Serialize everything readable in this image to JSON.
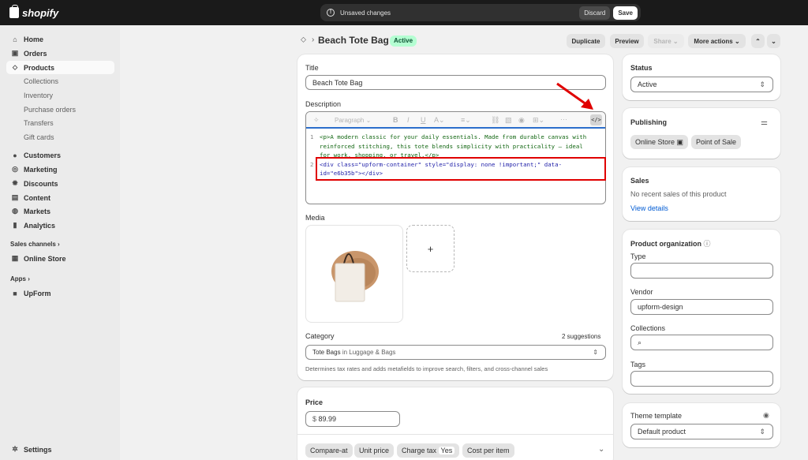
{
  "topbar": {
    "brand": "shopify",
    "unsaved": "Unsaved changes",
    "discard": "Discard",
    "save": "Save"
  },
  "sidebar": {
    "home": "Home",
    "orders": "Orders",
    "products": "Products",
    "collections": "Collections",
    "inventory": "Inventory",
    "purchase_orders": "Purchase orders",
    "transfers": "Transfers",
    "gift_cards": "Gift cards",
    "customers": "Customers",
    "marketing": "Marketing",
    "discounts": "Discounts",
    "content": "Content",
    "markets": "Markets",
    "analytics": "Analytics",
    "sales_channels": "Sales channels",
    "online_store": "Online Store",
    "apps": "Apps",
    "upform": "UpForm",
    "settings": "Settings"
  },
  "header": {
    "title": "Beach Tote Bag",
    "badge": "Active",
    "duplicate": "Duplicate",
    "preview": "Preview",
    "share": "Share",
    "more_actions": "More actions"
  },
  "product": {
    "title_label": "Title",
    "title_value": "Beach Tote Bag",
    "description_label": "Description",
    "toolbar_paragraph": "Paragraph",
    "code_line1_a": "<p>A modern classic for your daily essentials. Made from durable canvas with",
    "code_line1_b": "reinforced stitching, this tote blends simplicity with practicality — ideal",
    "code_line1_c": "for work, shopping, or travel.</p>",
    "code_line2_a": "<div class=\"upform-container\" style=\"display: none !important;\" data-",
    "code_line2_b": "id=\"e6b35b\"></div>",
    "media_label": "Media",
    "category_label": "Category",
    "category_suggestions": "2 suggestions",
    "category_value": "Tote Bags",
    "category_in": "in Luggage & Bags",
    "category_help": "Determines tax rates and adds metafields to improve search, filters, and cross-channel sales"
  },
  "pricing": {
    "label": "Price",
    "currency": "$",
    "value": "89.99",
    "compare_at": "Compare-at",
    "unit_price": "Unit price",
    "charge_tax": "Charge tax",
    "charge_tax_value": "Yes",
    "cost_per_item": "Cost per item"
  },
  "status": {
    "label": "Status",
    "value": "Active"
  },
  "publishing": {
    "label": "Publishing",
    "online_store": "Online Store",
    "point_of_sale": "Point of Sale"
  },
  "sales": {
    "label": "Sales",
    "text": "No recent sales of this product",
    "link": "View details"
  },
  "organization": {
    "label": "Product organization",
    "type": "Type",
    "vendor": "Vendor",
    "vendor_value": "upform-design",
    "collections": "Collections",
    "tags": "Tags"
  },
  "theme": {
    "label": "Theme template",
    "value": "Default product"
  }
}
